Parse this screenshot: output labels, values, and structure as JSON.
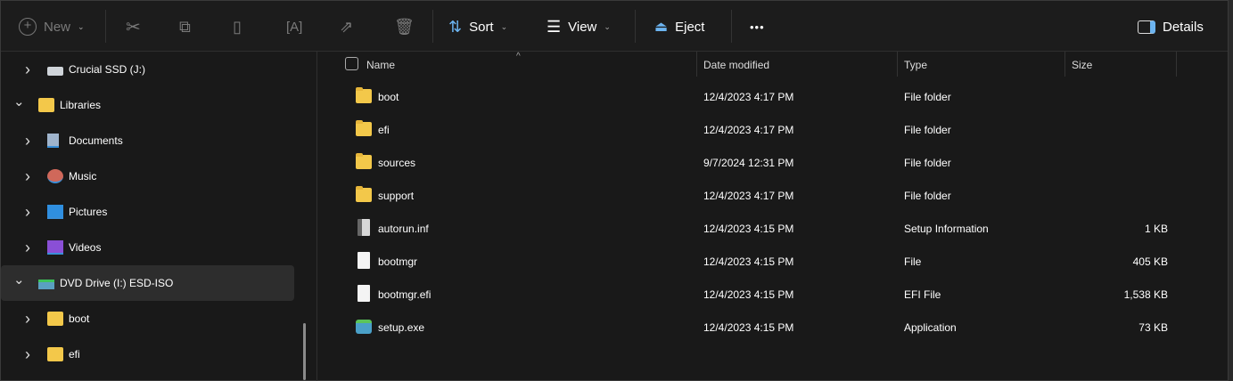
{
  "toolbar": {
    "new_label": "New",
    "sort_label": "Sort",
    "view_label": "View",
    "eject_label": "Eject",
    "more_label": "•••",
    "details_label": "Details"
  },
  "sidebar": {
    "items": [
      {
        "label": "Crucial SSD (J:)",
        "icon": "drive-icon",
        "expanded": false
      },
      {
        "label": "Libraries",
        "icon": "folder-icon",
        "expanded": true
      },
      {
        "label": "Documents",
        "icon": "documents-icon",
        "expanded": false
      },
      {
        "label": "Music",
        "icon": "music-icon",
        "expanded": false
      },
      {
        "label": "Pictures",
        "icon": "pictures-icon",
        "expanded": false
      },
      {
        "label": "Videos",
        "icon": "videos-icon",
        "expanded": false
      },
      {
        "label": "DVD Drive (I:) ESD-ISO",
        "icon": "dvd-drive-icon",
        "expanded": true,
        "selected": true
      },
      {
        "label": "boot",
        "icon": "folder-icon",
        "expanded": false
      },
      {
        "label": "efi",
        "icon": "folder-icon",
        "expanded": false
      }
    ]
  },
  "columns": {
    "name": "Name",
    "date": "Date modified",
    "type": "Type",
    "size": "Size"
  },
  "files": [
    {
      "name": "boot",
      "date": "12/4/2023 4:17 PM",
      "type": "File folder",
      "size": "",
      "kind": "folder"
    },
    {
      "name": "efi",
      "date": "12/4/2023 4:17 PM",
      "type": "File folder",
      "size": "",
      "kind": "folder"
    },
    {
      "name": "sources",
      "date": "9/7/2024 12:31 PM",
      "type": "File folder",
      "size": "",
      "kind": "folder"
    },
    {
      "name": "support",
      "date": "12/4/2023 4:17 PM",
      "type": "File folder",
      "size": "",
      "kind": "folder"
    },
    {
      "name": "autorun.inf",
      "date": "12/4/2023 4:15 PM",
      "type": "Setup Information",
      "size": "1 KB",
      "kind": "inf"
    },
    {
      "name": "bootmgr",
      "date": "12/4/2023 4:15 PM",
      "type": "File",
      "size": "405 KB",
      "kind": "file"
    },
    {
      "name": "bootmgr.efi",
      "date": "12/4/2023 4:15 PM",
      "type": "EFI File",
      "size": "1,538 KB",
      "kind": "file"
    },
    {
      "name": "setup.exe",
      "date": "12/4/2023 4:15 PM",
      "type": "Application",
      "size": "73 KB",
      "kind": "exe"
    }
  ]
}
